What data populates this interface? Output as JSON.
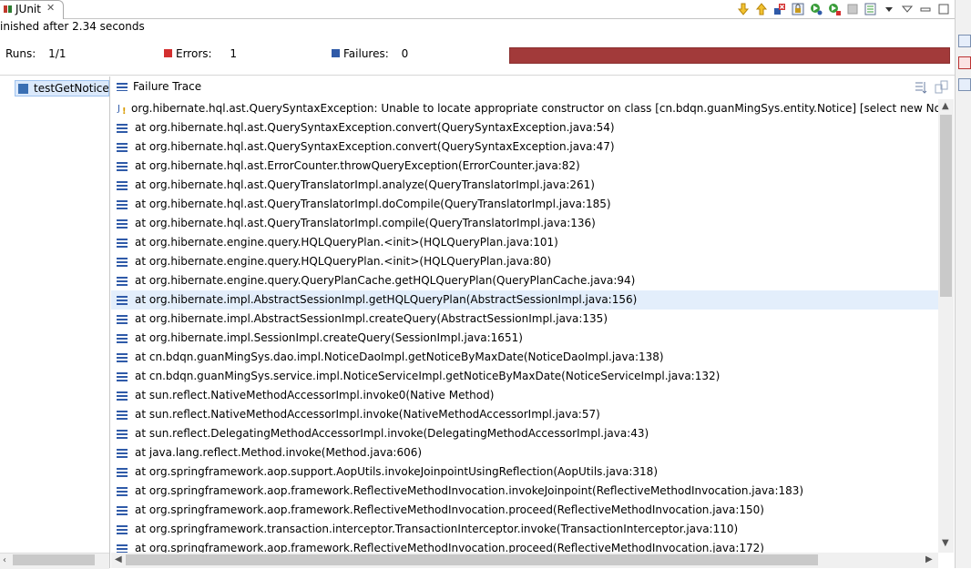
{
  "tab": {
    "title": "JUnit",
    "close": "✕"
  },
  "status": {
    "finished": "inished after 2.34 seconds"
  },
  "counters": {
    "runs_label": "Runs:",
    "runs_value": "1/1",
    "errors_label": "Errors:",
    "errors_value": "1",
    "failures_label": "Failures:",
    "failures_value": "0"
  },
  "progress": {
    "state": "failed",
    "color": "#a23a3a"
  },
  "test_tree": {
    "item": "testGetNoticeByMaxDate"
  },
  "trace": {
    "title": "Failure Trace",
    "lines": [
      "org.hibernate.hql.ast.QuerySyntaxException: Unable to locate appropriate constructor on class [cn.bdqn.guanMingSys.entity.Notice] [select new Notice (n",
      "at org.hibernate.hql.ast.QuerySyntaxException.convert(QuerySyntaxException.java:54)",
      "at org.hibernate.hql.ast.QuerySyntaxException.convert(QuerySyntaxException.java:47)",
      "at org.hibernate.hql.ast.ErrorCounter.throwQueryException(ErrorCounter.java:82)",
      "at org.hibernate.hql.ast.QueryTranslatorImpl.analyze(QueryTranslatorImpl.java:261)",
      "at org.hibernate.hql.ast.QueryTranslatorImpl.doCompile(QueryTranslatorImpl.java:185)",
      "at org.hibernate.hql.ast.QueryTranslatorImpl.compile(QueryTranslatorImpl.java:136)",
      "at org.hibernate.engine.query.HQLQueryPlan.<init>(HQLQueryPlan.java:101)",
      "at org.hibernate.engine.query.HQLQueryPlan.<init>(HQLQueryPlan.java:80)",
      "at org.hibernate.engine.query.QueryPlanCache.getHQLQueryPlan(QueryPlanCache.java:94)",
      "at org.hibernate.impl.AbstractSessionImpl.getHQLQueryPlan(AbstractSessionImpl.java:156)",
      "at org.hibernate.impl.AbstractSessionImpl.createQuery(AbstractSessionImpl.java:135)",
      "at org.hibernate.impl.SessionImpl.createQuery(SessionImpl.java:1651)",
      "at cn.bdqn.guanMingSys.dao.impl.NoticeDaoImpl.getNoticeByMaxDate(NoticeDaoImpl.java:138)",
      "at cn.bdqn.guanMingSys.service.impl.NoticeServiceImpl.getNoticeByMaxDate(NoticeServiceImpl.java:132)",
      "at sun.reflect.NativeMethodAccessorImpl.invoke0(Native Method)",
      "at sun.reflect.NativeMethodAccessorImpl.invoke(NativeMethodAccessorImpl.java:57)",
      "at sun.reflect.DelegatingMethodAccessorImpl.invoke(DelegatingMethodAccessorImpl.java:43)",
      "at java.lang.reflect.Method.invoke(Method.java:606)",
      "at org.springframework.aop.support.AopUtils.invokeJoinpointUsingReflection(AopUtils.java:318)",
      "at org.springframework.aop.framework.ReflectiveMethodInvocation.invokeJoinpoint(ReflectiveMethodInvocation.java:183)",
      "at org.springframework.aop.framework.ReflectiveMethodInvocation.proceed(ReflectiveMethodInvocation.java:150)",
      "at org.springframework.transaction.interceptor.TransactionInterceptor.invoke(TransactionInterceptor.java:110)",
      "at org.springframework.aop.framework.ReflectiveMethodInvocation.proceed(ReflectiveMethodInvocation.java:172)"
    ]
  },
  "icons": {
    "tab": "junit-icon",
    "toolbar": [
      "next-failure-icon",
      "previous-failure-icon",
      "show-failures-only-icon",
      "scroll-lock-icon",
      "rerun-test-icon",
      "rerun-failed-first-icon",
      "stop-icon",
      "test-run-history-icon",
      "view-menu-icon",
      "minimize-icon",
      "maximize-icon"
    ]
  }
}
